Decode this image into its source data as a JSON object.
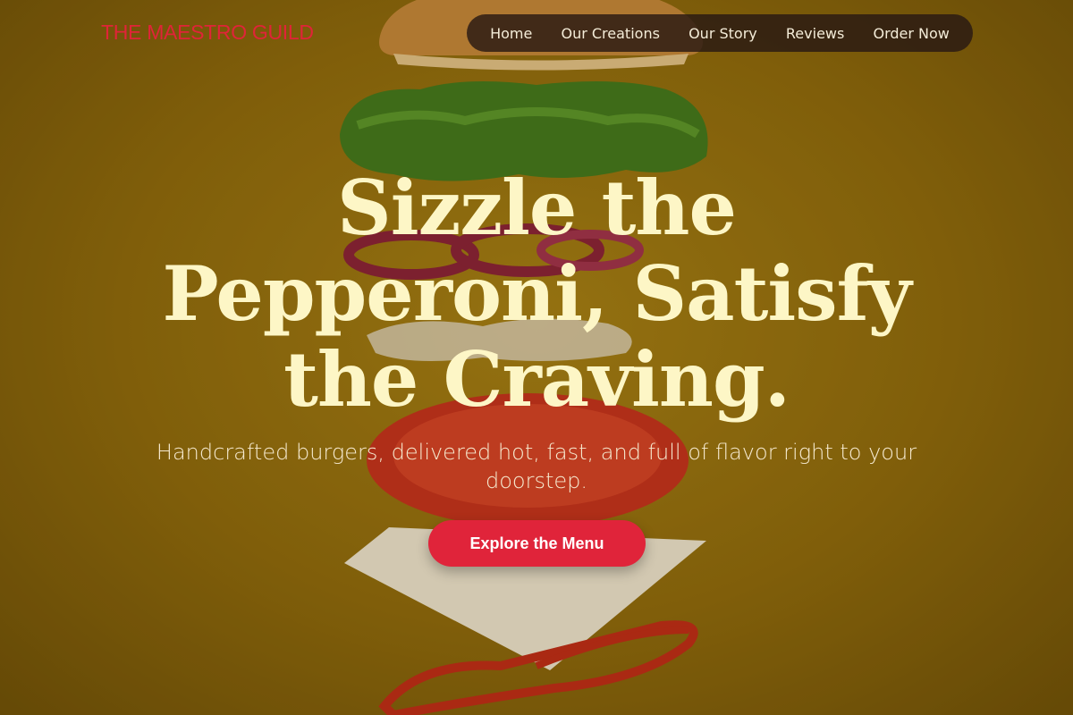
{
  "brand": {
    "logo_text": "THE MAESTRO GUILD",
    "accent_color": "#e0243a"
  },
  "nav": {
    "items": [
      {
        "label": "Home"
      },
      {
        "label": "Our Creations"
      },
      {
        "label": "Our Story"
      },
      {
        "label": "Reviews"
      },
      {
        "label": "Order Now"
      }
    ]
  },
  "hero": {
    "headline": "Sizzle the Pepperoni, Satisfy the Craving.",
    "subheadline": "Handcrafted burgers, delivered hot, fast, and full of flavor right to your doorstep.",
    "cta_label": "Explore the Menu",
    "background_image": "exploded-burger-photo",
    "background_color": "#9a7410"
  }
}
